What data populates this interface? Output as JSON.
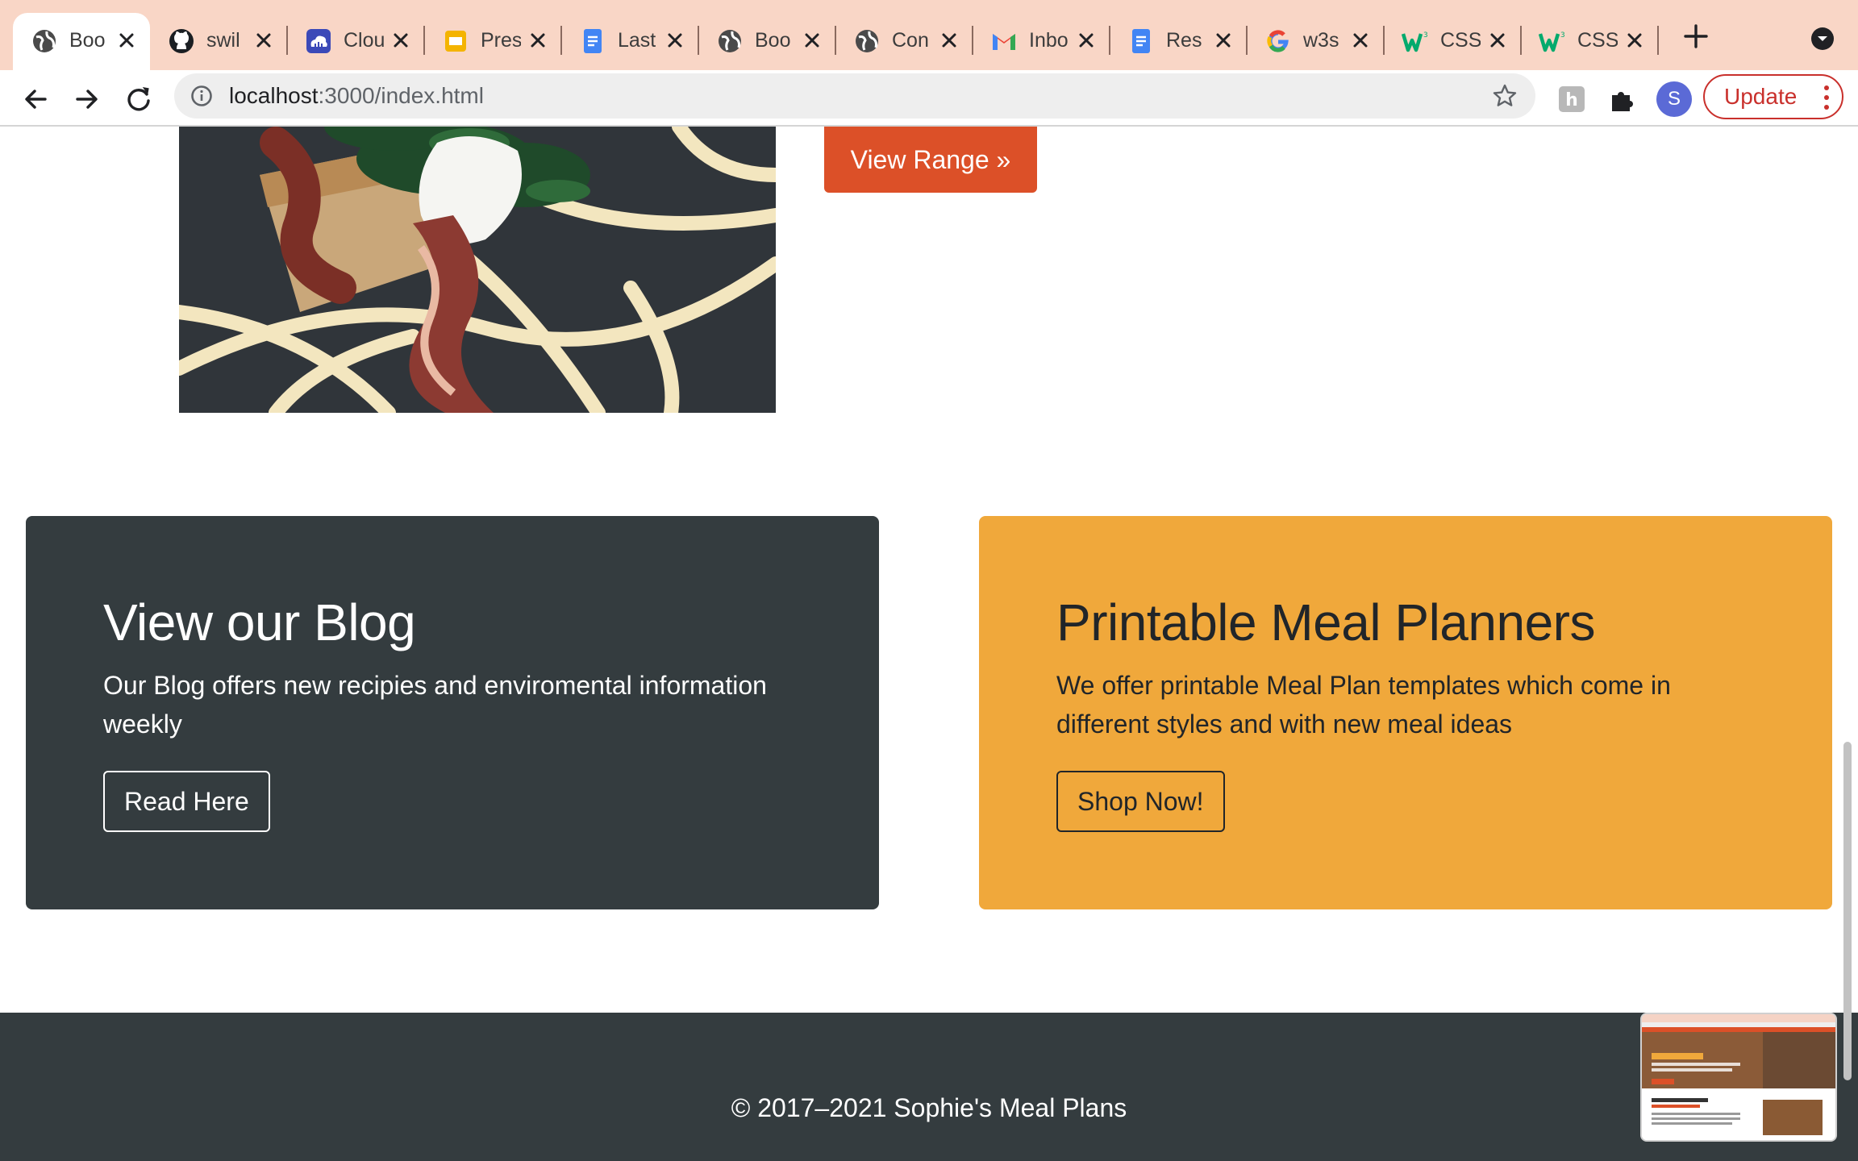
{
  "browser": {
    "tabs": [
      {
        "title": "Boo",
        "icon": "globe-icon",
        "active": true
      },
      {
        "title": "swil",
        "icon": "github-icon"
      },
      {
        "title": "Clou",
        "icon": "cloud-icon"
      },
      {
        "title": "Pres",
        "icon": "slides-icon"
      },
      {
        "title": "Last",
        "icon": "docs-icon"
      },
      {
        "title": "Boo",
        "icon": "globe-icon"
      },
      {
        "title": "Con",
        "icon": "globe-icon"
      },
      {
        "title": "Inbo",
        "icon": "gmail-icon"
      },
      {
        "title": "Res",
        "icon": "docs-icon"
      },
      {
        "title": "w3s",
        "icon": "google-icon"
      },
      {
        "title": "CSS",
        "icon": "w3-icon"
      },
      {
        "title": "CSS",
        "icon": "w3-icon"
      }
    ],
    "address": {
      "host": "localhost",
      "path": ":3000/index.html"
    },
    "profile_initial": "S",
    "update_label": "Update"
  },
  "page": {
    "view_range_label": "View Range »",
    "blog": {
      "title": "View our Blog",
      "text": "Our Blog offers new recipies and enviromental information weekly",
      "button": "Read Here"
    },
    "planner": {
      "title": "Printable Meal Planners",
      "text": "We offer printable Meal Plan templates which come in different styles and with new meal ideas",
      "button": "Shop Now!"
    },
    "footer": "© 2017–2021 Sophie's Meal Plans"
  },
  "colors": {
    "tab_strip": "#f9d6c6",
    "accent_orange": "#dc5028",
    "dark_card": "#343c3f",
    "planner_card": "#f0a83b"
  }
}
